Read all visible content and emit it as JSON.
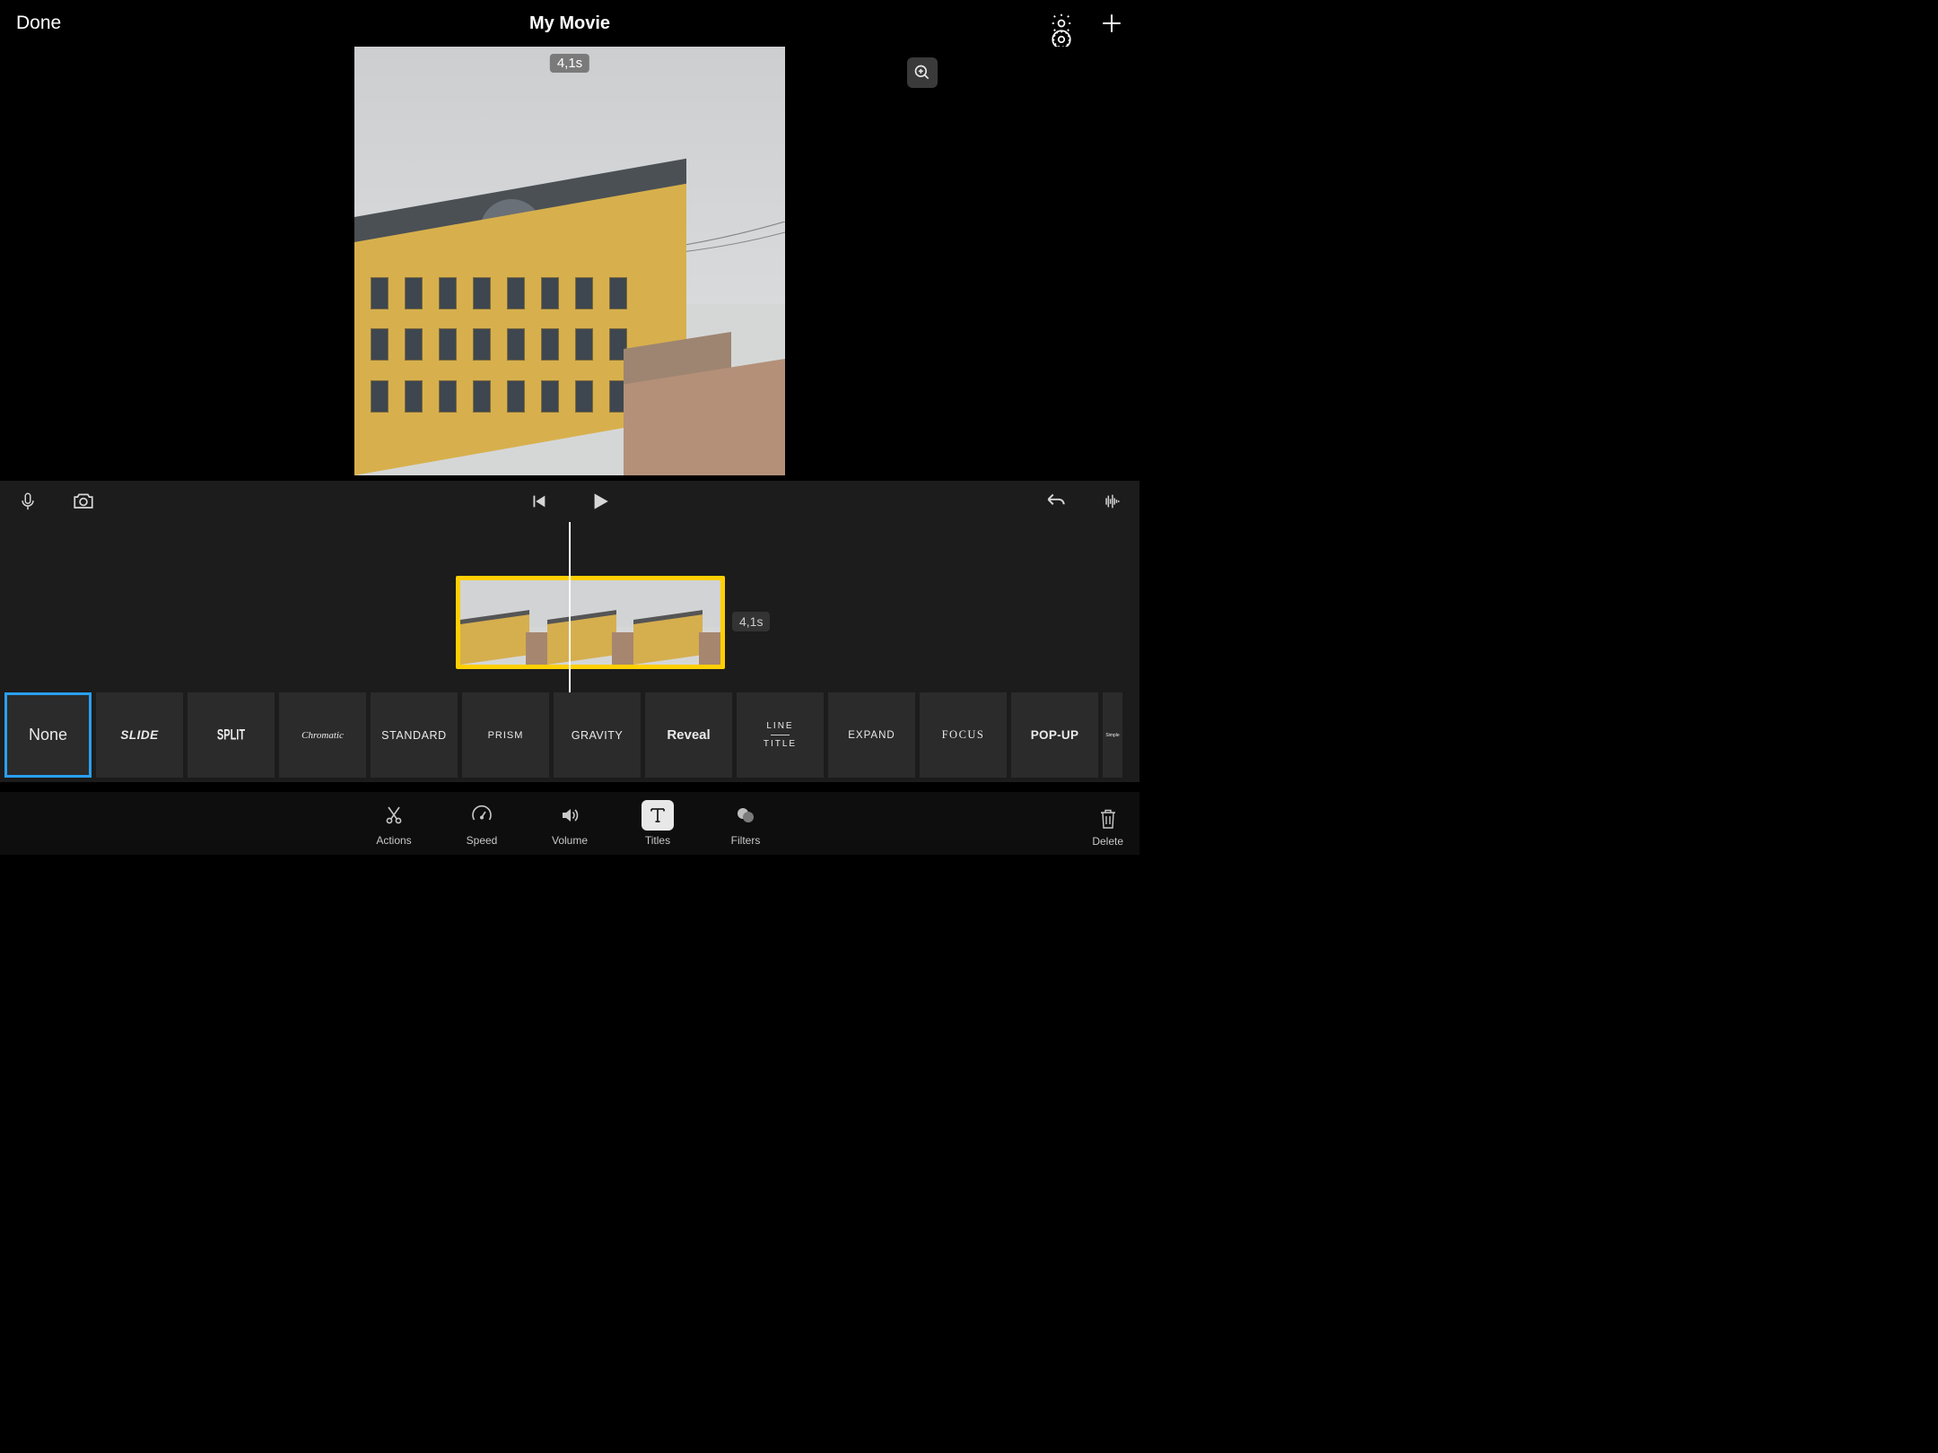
{
  "header": {
    "done_label": "Done",
    "title": "My Movie"
  },
  "preview": {
    "duration_badge": "4,1s"
  },
  "timeline": {
    "clip_duration": "4,1s"
  },
  "titles": [
    {
      "id": "none",
      "label": "None",
      "selected": true
    },
    {
      "id": "slide",
      "label": "SLIDE"
    },
    {
      "id": "split",
      "label": "SPLIT"
    },
    {
      "id": "chromatic",
      "label": "Chromatic"
    },
    {
      "id": "standard",
      "label": "STANDARD"
    },
    {
      "id": "prism",
      "label": "PRISM"
    },
    {
      "id": "gravity",
      "label": "GRAVITY"
    },
    {
      "id": "reveal",
      "label": "Reveal"
    },
    {
      "id": "line",
      "label_top": "LINE",
      "label_bottom": "TITLE"
    },
    {
      "id": "expand",
      "label": "EXPAND"
    },
    {
      "id": "focus",
      "label": "FOCUS"
    },
    {
      "id": "popup",
      "label": "POP-UP"
    },
    {
      "id": "simple",
      "label": "Simple"
    }
  ],
  "tools": {
    "actions": "Actions",
    "speed": "Speed",
    "volume": "Volume",
    "titles": "Titles",
    "filters": "Filters",
    "delete": "Delete"
  }
}
